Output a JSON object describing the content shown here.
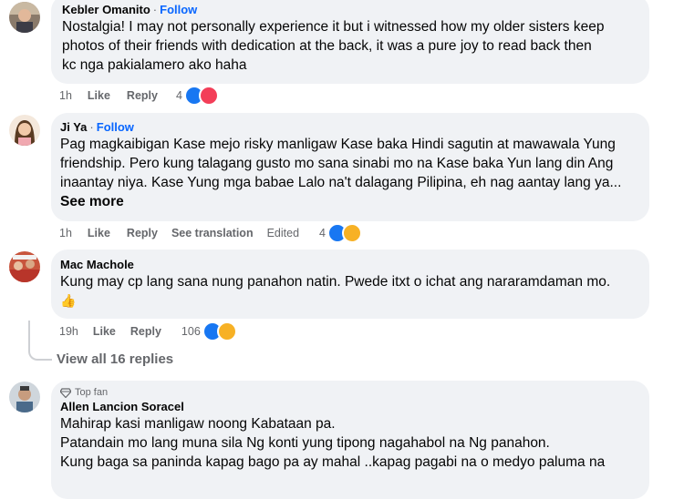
{
  "comments": [
    {
      "author": "Kebler Omanito",
      "follow": "Follow",
      "lines": [
        "Nostalgia! I may not personally experience it but i witnessed how my older sisters keep",
        "photos of their friends with dedication at the back, it was a pure joy to read back then",
        "kc nga pakialamero ako haha"
      ],
      "time": "1h",
      "like": "Like",
      "reply": "Reply",
      "reaction_count": "4"
    },
    {
      "author": "Ji Ya",
      "follow": "Follow",
      "lines": [
        "Pag magkaibigan Kase mejo risky manligaw Kase baka Hindi sagutin at mawawala Yung",
        "friendship. Pero kung talagang gusto mo sana sinabi mo na Kase baka Yun lang din Ang",
        "inaantay niya. Kase Yung mga babae Lalo na't dalagang Pilipina, eh nag aantay lang ya..."
      ],
      "see_more": "See more",
      "time": "1h",
      "like": "Like",
      "reply": "Reply",
      "see_translation": "See translation",
      "edited": "Edited",
      "reaction_count": "4"
    },
    {
      "author": "Mac Machole",
      "lines": [
        "Kung may cp lang sana nung panahon natin. Pwede itxt o ichat ang nararamdaman mo."
      ],
      "emoji": "👍",
      "time": "19h",
      "like": "Like",
      "reply": "Reply",
      "reaction_count": "106",
      "view_replies": "View all 16 replies"
    },
    {
      "badge": "Top fan",
      "author": "Allen Lancion Soracel",
      "lines": [
        "Mahirap kasi manligaw noong Kabataan pa.",
        "Patandain mo lang muna sila Ng konti yung tipong nagahabol na Ng panahon.",
        "Kung baga sa paninda kapag bago pa ay mahal ..kapag pagabi na o medyo paluma na"
      ]
    }
  ]
}
